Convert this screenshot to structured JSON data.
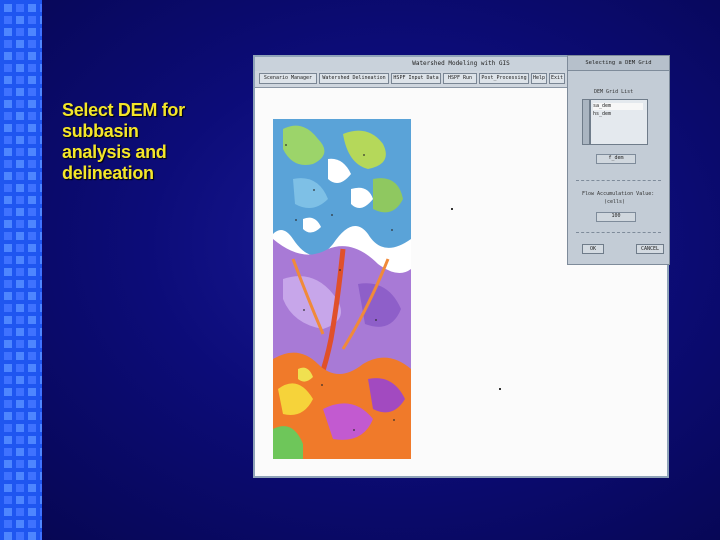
{
  "slide": {
    "caption": "Select DEM for\nsubbasin\nanalysis and\ndelineation"
  },
  "main_window": {
    "title": "Watershed Modeling with GIS",
    "menu": [
      {
        "label": "Scenario Manager"
      },
      {
        "label": "Watershed Delineation"
      },
      {
        "label": "HSPF Input Data"
      },
      {
        "label": "HSPF Run"
      },
      {
        "label": "Post_Processing"
      },
      {
        "label": "Help"
      },
      {
        "label": "Exit"
      }
    ]
  },
  "dialog": {
    "title": "Selecting a DEM Grid",
    "list_label": "DEM Grid List",
    "items": [
      {
        "label": "sa_dem",
        "selected": true
      },
      {
        "label": "hs_dem",
        "selected": false
      }
    ],
    "selected_value": "f_dem",
    "threshold_label": "Flow Accumulation Value:",
    "threshold_unit": "(cells)",
    "threshold_value": "100",
    "ok_label": "OK",
    "cancel_label": "CANCEL"
  },
  "colors": {
    "background": "#0a0a6e",
    "accent_bar": "#1f56f0",
    "caption": "#f4e62a"
  }
}
